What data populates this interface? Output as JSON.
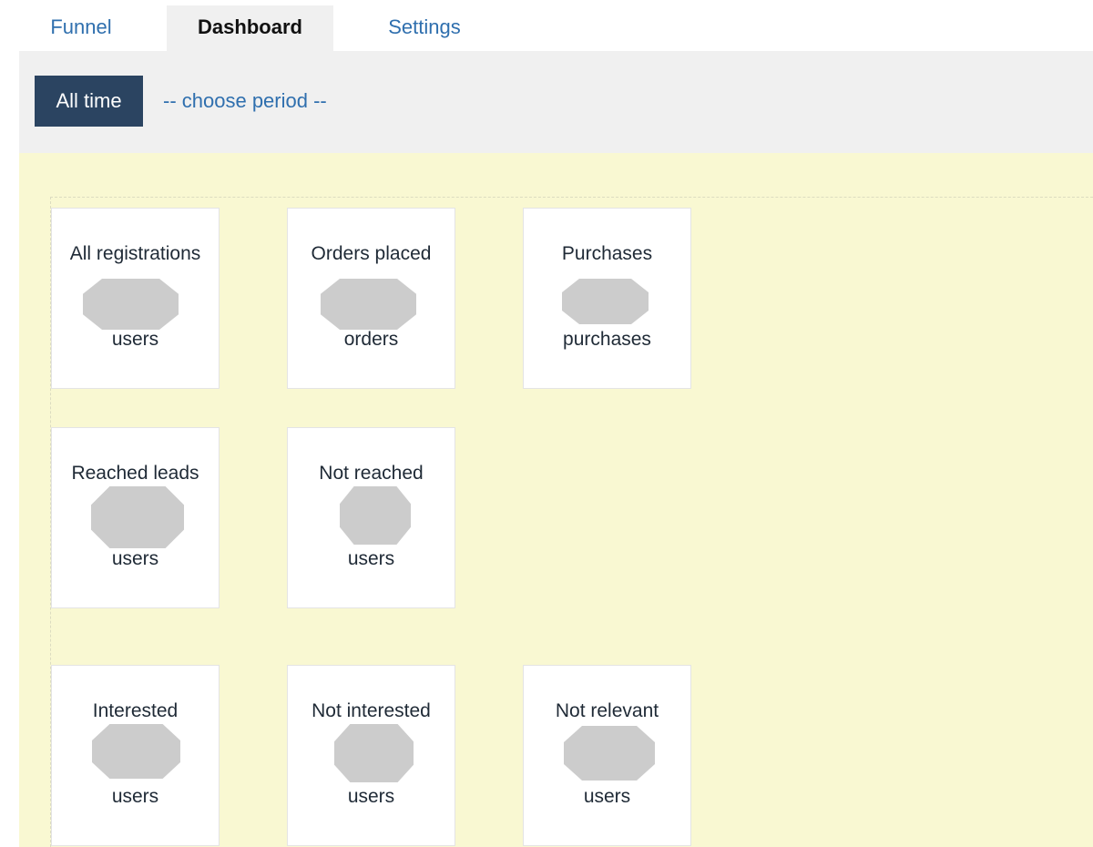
{
  "tabs": [
    {
      "label": "Funnel"
    },
    {
      "label": "Dashboard"
    },
    {
      "label": "Settings"
    }
  ],
  "filter": {
    "active_period": "All time",
    "chooser_label": "-- choose period --"
  },
  "cards": [
    {
      "label": "All registrations",
      "unit": "users"
    },
    {
      "label": "Orders placed",
      "unit": "orders"
    },
    {
      "label": "Purchases",
      "unit": "purchases"
    },
    {
      "label": "Reached leads",
      "unit": "users"
    },
    {
      "label": "Not reached",
      "unit": "users"
    },
    {
      "label": "Interested",
      "unit": "users"
    },
    {
      "label": "Not interested",
      "unit": "users"
    },
    {
      "label": "Not relevant",
      "unit": "users"
    }
  ],
  "colors": {
    "link": "#2f6fae",
    "active_period_bg": "#2b4461",
    "dashboard_bg": "#f9f8d2",
    "redacted_value": "#cccccc"
  }
}
